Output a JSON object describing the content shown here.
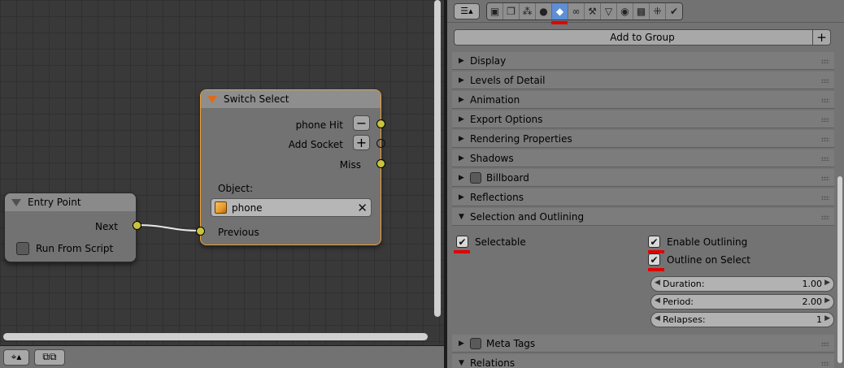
{
  "node_editor": {
    "switch_node": {
      "title": "Switch Select",
      "socket_phone_hit": "phone Hit",
      "socket_add": "Add Socket",
      "socket_miss": "Miss",
      "object_label": "Object:",
      "object_value": "phone",
      "input_previous": "Previous"
    },
    "entry_node": {
      "title": "Entry Point",
      "output_next": "Next",
      "checkbox_label": "Run From Script"
    }
  },
  "properties": {
    "add_group_label": "Add to Group",
    "panels": [
      {
        "label": "Display",
        "expanded": false
      },
      {
        "label": "Levels of Detail",
        "expanded": false
      },
      {
        "label": "Animation",
        "expanded": false
      },
      {
        "label": "Export Options",
        "expanded": false
      },
      {
        "label": "Rendering Properties",
        "expanded": false
      },
      {
        "label": "Shadows",
        "expanded": false
      },
      {
        "label": "Billboard",
        "expanded": false,
        "has_checkbox": true
      },
      {
        "label": "Reflections",
        "expanded": false
      },
      {
        "label": "Selection and Outlining",
        "expanded": true
      },
      {
        "label": "Meta Tags",
        "expanded": false,
        "has_checkbox": true
      },
      {
        "label": "Relations",
        "expanded": true
      }
    ],
    "selection": {
      "selectable": "Selectable",
      "enable_outlining": "Enable Outlining",
      "outline_on_select": "Outline on Select",
      "duration_label": "Duration:",
      "duration_value": "1.00",
      "period_label": "Period:",
      "period_value": "2.00",
      "relapses_label": "Relapses:",
      "relapses_value": "1"
    }
  },
  "colors": {
    "active_tab": "#5d8ed6",
    "highlight_underline": "#e00000",
    "node_active_border": "#f0a030",
    "socket": "#c8c43d"
  }
}
